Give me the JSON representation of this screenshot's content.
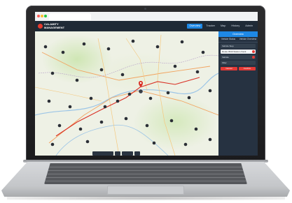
{
  "app": {
    "logo_text": "CALAMITY\nMANAGEMENT",
    "nav": [
      "Overview",
      "Tracker",
      "Map",
      "History",
      "Admin"
    ]
  },
  "browser": {
    "tab_title": ""
  },
  "panel": {
    "title": "Overview",
    "tabs": [
      "Vehicle Status",
      "Vehicle Overview"
    ],
    "rows": [
      "Vehicle Stop",
      "Route 4540 Station check",
      "Vehicle",
      "Filter"
    ],
    "buttons": [
      "Cancel",
      "Confirm"
    ]
  },
  "colors": {
    "header_bg": "#1f2a36",
    "accent": "#1e88e5",
    "alert": "#e53935",
    "panel_bg": "#263241"
  }
}
